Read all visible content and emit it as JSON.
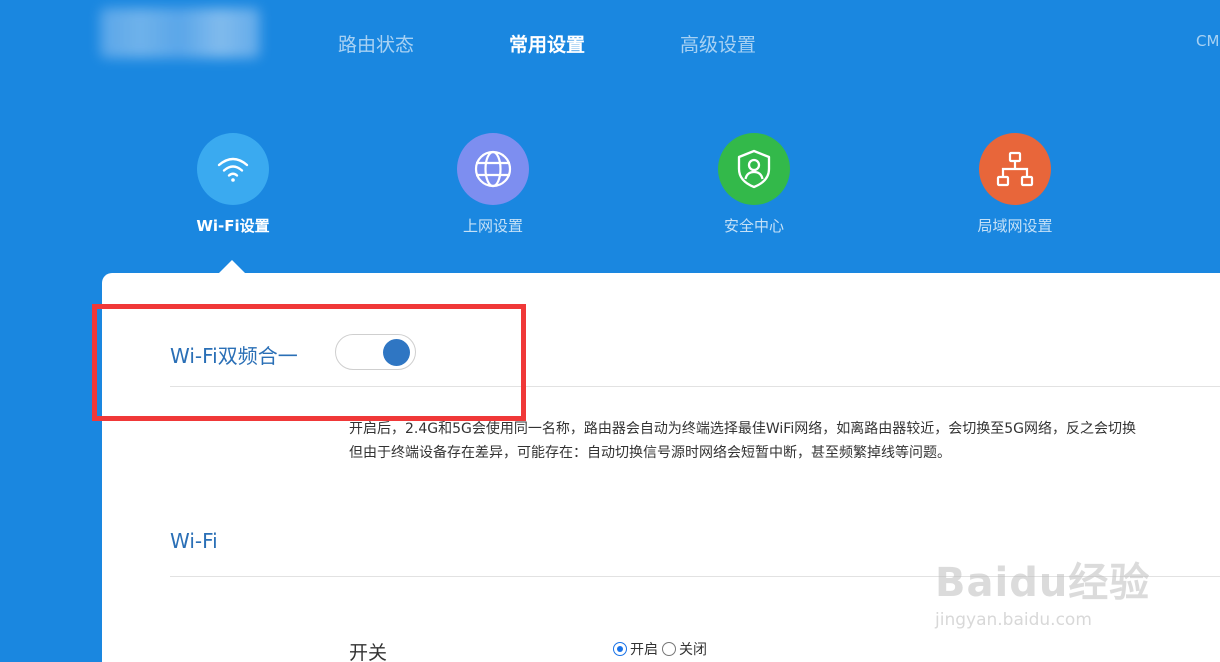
{
  "topnav": {
    "items": [
      {
        "label": "路由状态",
        "active": false
      },
      {
        "label": "常用设置",
        "active": true
      },
      {
        "label": "高级设置",
        "active": false
      }
    ],
    "user": "CM"
  },
  "features": [
    {
      "label": "Wi-Fi设置",
      "icon": "wifi-icon",
      "color": "#3aaaf0",
      "active": true
    },
    {
      "label": "上网设置",
      "icon": "globe-icon",
      "color": "#7d8ef0",
      "active": false
    },
    {
      "label": "安全中心",
      "icon": "shield-user-icon",
      "color": "#33b94a",
      "active": false
    },
    {
      "label": "局域网设置",
      "icon": "network-icon",
      "color": "#e8663a",
      "active": false
    }
  ],
  "dual_band": {
    "title": "Wi-Fi双频合一",
    "enabled": true,
    "desc_line1": "开启后，2.4G和5G会使用同一名称，路由器会自动为终端选择最佳WiFi网络，如离路由器较近，会切换至5G网络，反之会切换",
    "desc_line2": "但由于终端设备存在差异，可能存在：自动切换信号源时网络会短暂中断，甚至频繁掉线等问题。"
  },
  "wifi": {
    "title": "Wi-Fi",
    "switch_label": "开关",
    "options": [
      {
        "label": "开启",
        "checked": true
      },
      {
        "label": "关闭",
        "checked": false
      }
    ]
  },
  "watermark": {
    "main": "Baidu经验",
    "sub": "jingyan.baidu.com"
  },
  "colors": {
    "background": "#1a87e0",
    "highlight": "#f03838",
    "accent": "#2f76c3"
  }
}
